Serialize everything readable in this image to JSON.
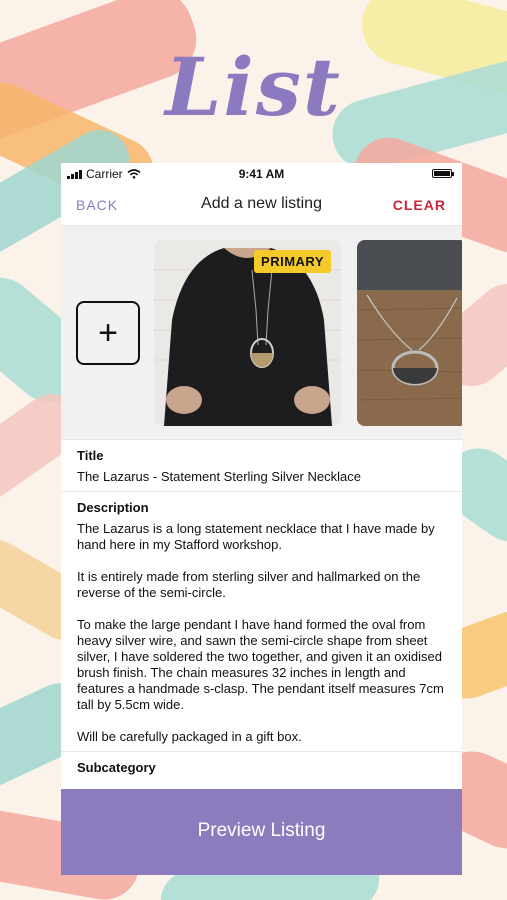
{
  "hero": {
    "title": "List"
  },
  "status_bar": {
    "carrier": "Carrier",
    "time": "9:41 AM"
  },
  "navbar": {
    "back_label": "BACK",
    "title": "Add a new listing",
    "clear_label": "CLEAR"
  },
  "photos": {
    "add_symbol": "+",
    "primary_badge": "PRIMARY"
  },
  "fields": {
    "title_label": "Title",
    "title_value": "The Lazarus - Statement Sterling Silver Necklace",
    "description_label": "Description",
    "description_paragraphs": [
      "The Lazarus is a long statement necklace that I have made by hand here in my Stafford workshop.",
      "It is entirely made from sterling silver and hallmarked on the reverse of the semi-circle.",
      "To make the large pendant I have hand formed the oval from heavy silver wire, and sawn the semi-circle shape from sheet silver, I have soldered the two together, and given it an oxidised brush finish. The chain measures 32 inches in length and features a handmade s-clasp. The pendant itself measures 7cm tall by 5.5cm wide.",
      "Will be carefully packaged in a gift box."
    ],
    "subcategory_label": "Subcategory"
  },
  "cta": {
    "preview_label": "Preview Listing"
  },
  "colors": {
    "accent": "#8c7bbd",
    "clear": "#c8243a",
    "badge": "#f4c92a"
  }
}
